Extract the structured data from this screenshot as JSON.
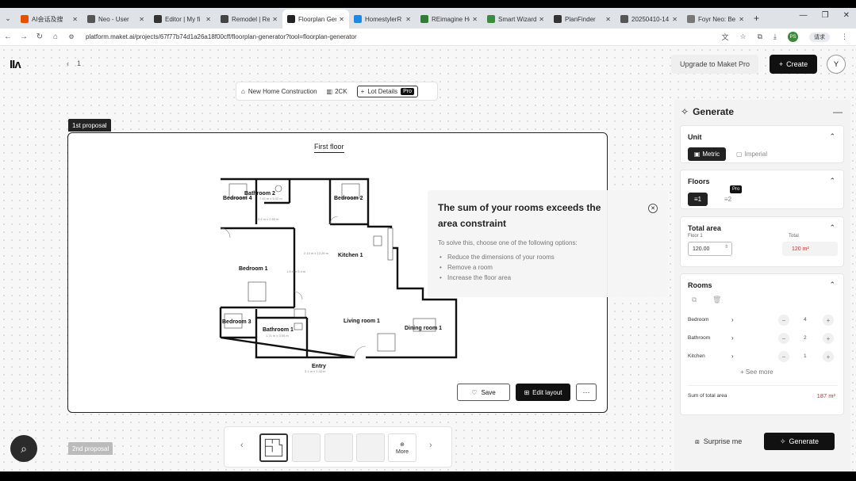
{
  "browser": {
    "tabs": [
      {
        "label": "AI会话及搜",
        "color": "#e65100",
        "active": false
      },
      {
        "label": "Neo - User",
        "color": "#555555",
        "active": false
      },
      {
        "label": "Editor | My fi",
        "color": "#333333",
        "active": false
      },
      {
        "label": "Remodel | Re",
        "color": "#444444",
        "active": false
      },
      {
        "label": "Floorplan Ger",
        "color": "#222222",
        "active": true
      },
      {
        "label": "HomestylerR",
        "color": "#1e88e5",
        "active": false
      },
      {
        "label": "REimagine Ho",
        "color": "#2e7d32",
        "active": false
      },
      {
        "label": "Smart Wizard",
        "color": "#388e3c",
        "active": false
      },
      {
        "label": "PlanFinder",
        "color": "#333333",
        "active": false
      },
      {
        "label": "20250410-14",
        "color": "#555555",
        "active": false
      },
      {
        "label": "Foyr Neo: Be",
        "color": "#777777",
        "active": false
      }
    ],
    "url": "platform.maket.ai/projects/67f77b74d1a26a18f00cff/floorplan-generator?tool=floorplan-generator",
    "profile_initial": "PS",
    "ext_label": "请求"
  },
  "app": {
    "logo": "IIʌ",
    "page_number": "1",
    "upgrade_label": "Upgrade to Maket Pro",
    "create_label": "Create",
    "user_initial": "Y",
    "toolbar": {
      "project_type": "New Home Construction",
      "area_label": "2CK",
      "lot_details": "Lot Details",
      "pro_tag": "Pro"
    }
  },
  "proposal": {
    "tag": "1st proposal",
    "floor_title": "First floor",
    "rooms": {
      "bedroom4": "Bedroom 4",
      "bathroom2": "Bathroom 2",
      "bedroom2": "Bedroom 2",
      "bedroom1": "Bedroom 1",
      "kitchen": "Kitchen 1",
      "bedroom3": "Bedroom 3",
      "bathroom1": "Bathroom 1",
      "living": "Living room 1",
      "dining": "Dining room 1",
      "entry": "Entry"
    },
    "dims": {
      "hall": "2.13 m x 13.26 m",
      "mid": "1.8 m x 5.4 m",
      "top": "7.42 m x 5.02 m",
      "corr": "2.4 m x 2.53 m",
      "bath2": "1.71 m x 3.05 m",
      "entry": "3.1 m x 1.42 m"
    },
    "save_label": "Save",
    "edit_label": "Edit layout",
    "more_label": "···"
  },
  "second_proposal_tag": "2nd proposal",
  "warning": {
    "title": "The sum of your rooms exceeds the area constraint",
    "subtitle": "To solve this, choose one of the following options:",
    "options": [
      "Reduce the dimensions of your rooms",
      "Remove a room",
      "Increase the floor area"
    ]
  },
  "thumbs": {
    "more_label": "More"
  },
  "generate": {
    "title": "Generate",
    "unit": {
      "title": "Unit",
      "metric": "Metric",
      "imperial": "Imperial"
    },
    "floors": {
      "title": "Floors",
      "one": "1",
      "two": "2",
      "pro_badge": "Pro"
    },
    "total_area": {
      "title": "Total area",
      "floor_label": "Floor 1",
      "total_label": "Total",
      "floor_value": "120.00",
      "total_value": "120 m²"
    },
    "rooms": {
      "title": "Rooms",
      "items": [
        {
          "name": "Bedroom",
          "count": "4"
        },
        {
          "name": "Bathroom",
          "count": "2"
        },
        {
          "name": "Kitchen",
          "count": "1"
        }
      ],
      "see_more": "See more",
      "sum_label": "Sum of total area",
      "sum_value": "187 m²"
    },
    "surprise_label": "Surprise me",
    "generate_label": "Generate"
  }
}
